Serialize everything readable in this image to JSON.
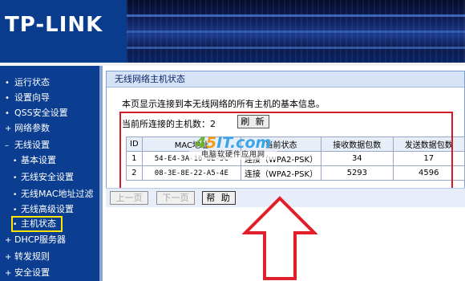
{
  "header": {
    "logo_text": "TP-LINK"
  },
  "sidebar": {
    "items": [
      {
        "label": "运行状态",
        "bullet": "•"
      },
      {
        "label": "设置向导",
        "bullet": "•"
      },
      {
        "label": "QSS安全设置",
        "bullet": "•"
      },
      {
        "label": "网络参数",
        "bullet": "+"
      },
      {
        "label": "无线设置",
        "bullet": "–"
      },
      {
        "label": "基本设置",
        "bullet": "•"
      },
      {
        "label": "无线安全设置",
        "bullet": "•"
      },
      {
        "label": "无线MAC地址过滤",
        "bullet": "•"
      },
      {
        "label": "无线高级设置",
        "bullet": "•"
      },
      {
        "label": "主机状态",
        "bullet": "•"
      },
      {
        "label": "DHCP服务器",
        "bullet": "+"
      },
      {
        "label": "转发规则",
        "bullet": "+"
      },
      {
        "label": "安全设置",
        "bullet": "+"
      }
    ],
    "active_index": 9
  },
  "panel": {
    "title": "无线网络主机状态",
    "intro": "本页显示连接到本无线网络的所有主机的基本信息。",
    "count_label": "当前所连接的主机数：",
    "count_value": "2",
    "refresh_label": "刷 新"
  },
  "table": {
    "headers": [
      "ID",
      "MAC地址",
      "当前状态",
      "接收数据包数",
      "发送数据包数"
    ],
    "rows": [
      {
        "id": "1",
        "mac": "54-E4-3A-16-8E-5C",
        "status": "连接（WPA2-PSK）",
        "rx": "34",
        "tx": "17"
      },
      {
        "id": "2",
        "mac": "08-3E-8E-22-A5-4E",
        "status": "连接（WPA2-PSK）",
        "rx": "5293",
        "tx": "4596"
      }
    ]
  },
  "buttons": {
    "prev_label": "上一页",
    "next_label": "下一页",
    "help_label": "帮 助"
  },
  "watermark": {
    "w1": "4",
    "w2": "5",
    "rest": "IT.com",
    "sub": "电脑软硬件应用网"
  },
  "colors": {
    "nav_bg": "#0b3d91",
    "highlight_box": "#d11a2a",
    "active_outline": "#ffe600"
  }
}
